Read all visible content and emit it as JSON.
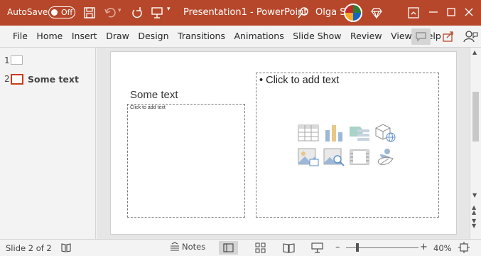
{
  "titlebar": {
    "autosave_label": "AutoSave",
    "autosave_state": "Off",
    "document_title": "Presentation1  -  PowerPoint",
    "user_name": "Olga S",
    "accent_color": "#b7472a",
    "icons": [
      "save-icon",
      "undo-icon",
      "redo-icon",
      "present-icon",
      "search-icon",
      "premium-diamond-icon",
      "ribbon-display-icon",
      "minimize-icon",
      "maximize-icon",
      "close-icon"
    ]
  },
  "ribbon": {
    "tabs": [
      "File",
      "Home",
      "Insert",
      "Draw",
      "Design",
      "Transitions",
      "Animations",
      "Slide Show",
      "Review",
      "View",
      "Help"
    ],
    "right_icons": [
      "comments-icon",
      "share-icon",
      "coauthor-icon"
    ]
  },
  "thumbnails": {
    "items": [
      {
        "number": "1",
        "label": "",
        "selected": false
      },
      {
        "number": "2",
        "label": "Some text",
        "selected": true
      }
    ]
  },
  "slide": {
    "title": "Some text",
    "left_placeholder": "Click to add text",
    "right_placeholder": "• Click to add text",
    "insert_icons": [
      "table-icon",
      "chart-icon",
      "smartart-icon",
      "3d-model-icon",
      "picture-icon",
      "online-picture-icon",
      "video-icon",
      "icons-icon"
    ]
  },
  "statusbar": {
    "slide_indicator": "Slide 2 of 2",
    "notes_label": "Notes",
    "zoom_level": "40%",
    "zoom_fraction": 0.16
  }
}
